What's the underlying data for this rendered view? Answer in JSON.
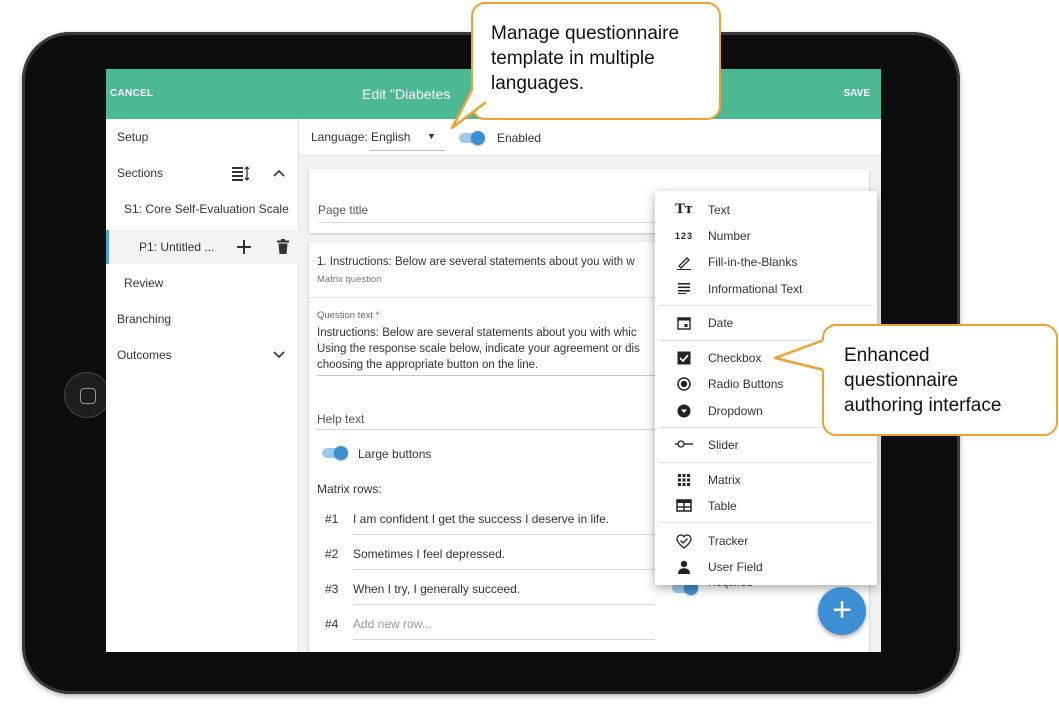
{
  "header": {
    "cancel_label": "CANCEL",
    "title": "Edit \"Diabetes",
    "save_label": "SAVE",
    "accent_color": "#4db894"
  },
  "sidebar": {
    "items": [
      {
        "label": "Setup"
      },
      {
        "label": "Sections"
      },
      {
        "label": "S1: Core Self-Evaluation Scale"
      },
      {
        "label": "P1: Untitled ..."
      },
      {
        "label": "Review"
      },
      {
        "label": "Branching"
      },
      {
        "label": "Outcomes"
      }
    ]
  },
  "langbar": {
    "language_label": "Language: English",
    "enabled_label": "Enabled",
    "enabled": true
  },
  "page_card": {
    "page_title_placeholder": "Page title"
  },
  "question": {
    "title": "1. Instructions: Below are several statements about you with w",
    "subtitle": "Matrix question",
    "text_label": "Question text",
    "text_required_mark": "*",
    "text_lines": [
      "Instructions: Below are several statements about you with whic",
      "Using the response scale below, indicate your agreement or dis",
      "choosing the appropriate button on the line."
    ],
    "help_placeholder": "Help text",
    "large_buttons_label": "Large buttons",
    "large_buttons_on": true,
    "matrix_rows_label": "Matrix rows:",
    "rows": [
      {
        "num": "#1",
        "text": "I am confident I get the success I deserve in life."
      },
      {
        "num": "#2",
        "text": "Sometimes I feel depressed."
      },
      {
        "num": "#3",
        "text": "When I try, I generally succeed."
      }
    ],
    "new_row": {
      "num": "#4",
      "placeholder": "Add new row..."
    },
    "required_label": "Required"
  },
  "type_menu": {
    "groups": [
      [
        {
          "icon": "text-icon",
          "label": "Text"
        },
        {
          "icon": "number-icon",
          "label": "Number"
        },
        {
          "icon": "pencil-icon",
          "label": "Fill-in-the-Blanks"
        },
        {
          "icon": "lines-icon",
          "label": "Informational Text"
        }
      ],
      [
        {
          "icon": "calendar-icon",
          "label": "Date"
        }
      ],
      [
        {
          "icon": "checkbox-icon",
          "label": "Checkbox"
        },
        {
          "icon": "radio-icon",
          "label": "Radio Buttons"
        },
        {
          "icon": "dropdown-icon",
          "label": "Dropdown"
        }
      ],
      [
        {
          "icon": "slider-icon",
          "label": "Slider"
        }
      ],
      [
        {
          "icon": "matrix-icon",
          "label": "Matrix"
        },
        {
          "icon": "table-icon",
          "label": "Table"
        }
      ],
      [
        {
          "icon": "tracker-icon",
          "label": "Tracker"
        },
        {
          "icon": "user-icon",
          "label": "User Field"
        }
      ]
    ]
  },
  "callouts": {
    "languages": [
      "Manage questionnaire",
      "template in multiple",
      "languages."
    ],
    "authoring": [
      "Enhanced",
      "questionnaire",
      "authoring interface"
    ],
    "border_color": "#f0a030"
  },
  "fab": {
    "label": "+",
    "color": "#3d8fd3"
  }
}
